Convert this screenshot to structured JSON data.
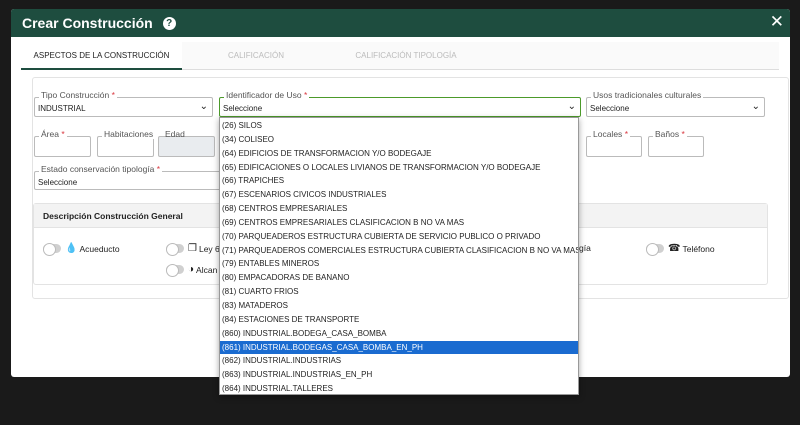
{
  "modal": {
    "title": "Crear Construcción",
    "help_icon": "?",
    "close_icon": "✕"
  },
  "tabs": [
    "ASPECTOS DE LA CONSTRUCCIÓN",
    "CALIFICACIÓN",
    "CALIFICACIÓN TIPOLOGÍA"
  ],
  "fields": {
    "tipo_construccion": {
      "label": "Tipo Construcción",
      "value": "INDUSTRIAL"
    },
    "identificador_uso": {
      "label": "Identificador de Uso",
      "value": "Seleccione"
    },
    "usos_tradicionales": {
      "label": "Usos tradicionales culturales",
      "value": "Seleccione"
    },
    "area": {
      "label": "Área"
    },
    "habitaciones": {
      "label": "Habitaciones"
    },
    "edad": {
      "label": "Edad"
    },
    "locales": {
      "label": "Locales"
    },
    "banos": {
      "label": "Baños"
    },
    "estado_conservacion": {
      "label": "Estado conservación tipología",
      "value": "Seleccione"
    }
  },
  "required_mark": "*",
  "section": {
    "title": "Descripción Construcción General",
    "toggles": {
      "acueducto": {
        "label": "Acueducto",
        "icon": "water-drop-icon"
      },
      "ley": {
        "label": "Ley 6",
        "icon": "copy-icon"
      },
      "alcantarillado": {
        "label": "Alcan",
        "icon": "contrast-icon"
      },
      "energia": {
        "label": "gía"
      },
      "telefono": {
        "label": "Teléfono",
        "icon": "phone-icon"
      }
    }
  },
  "dropdown_options": [
    "(26) SILOS",
    "(34) COLISEO",
    "(64) EDIFICIOS DE TRANSFORMACION Y/O BODEGAJE",
    "(65) EDIFICACIONES O LOCALES LIVIANOS DE TRANSFORMACION Y/O BODEGAJE",
    "(66) TRAPICHES",
    "(67) ESCENARIOS CIVICOS INDUSTRIALES",
    "(68) CENTROS EMPRESARIALES",
    "(69) CENTROS EMPRESARIALES CLASIFICACION B NO VA MAS",
    "(70) PARQUEADEROS ESTRUCTURA CUBIERTA DE SERVICIO PUBLICO O PRIVADO",
    "(71) PARQUEADEROS COMERCIALES ESTRUCTURA CUBIERTA CLASIFICACION B NO VA MAS",
    "(79) ENTABLES MINEROS",
    "(80) EMPACADORAS DE BANANO",
    "(81) CUARTO FRIOS",
    "(83) MATADEROS",
    "(84) ESTACIONES DE TRANSPORTE",
    "(860) INDUSTRIAL.BODEGA_CASA_BOMBA",
    "(861) INDUSTRIAL.BODEGAS_CASA_BOMBA_EN_PH",
    "(862) INDUSTRIAL.INDUSTRIAS",
    "(863) INDUSTRIAL.INDUSTRIAS_EN_PH",
    "(864) INDUSTRIAL.TALLERES"
  ],
  "dropdown_selected_index": 16,
  "colors": {
    "header": "#1e4d3f",
    "required": "#d9363e",
    "focus": "#4c9a2a",
    "selection": "#1a6bd0"
  }
}
